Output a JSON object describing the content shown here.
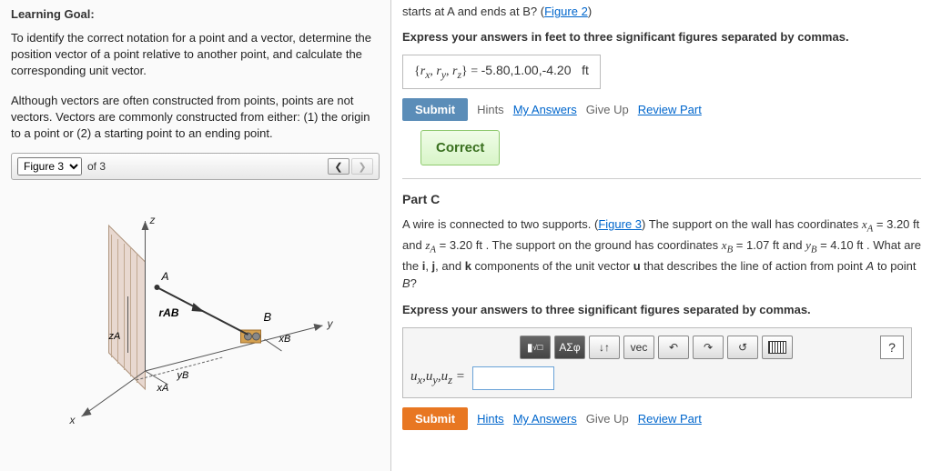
{
  "left": {
    "title": "Learning Goal:",
    "p1": "To identify the correct notation for a point and a vector, determine the position vector of a point relative to another point, and calculate the corresponding unit vector.",
    "p2": "Although vectors are often constructed from points, points are not vectors. Vectors are commonly constructed from either: (1) the origin to a point or (2) a starting point to an ending point.",
    "figSelect": "Figure 3",
    "ofText": "of 3"
  },
  "top": {
    "intro1": "starts at A and ends at B? (",
    "figLink": "Figure 2",
    "intro2": ")",
    "instruction": "Express your answers in feet to three significant figures separated by commas.",
    "answerPrefix": "{rₓ, rᵧ, r_z} = ",
    "answerValue": "-5.80,1.00,-4.20",
    "answerUnit": "ft",
    "submit": "Submit",
    "hints": "Hints",
    "myAnswers": "My Answers",
    "giveUp": "Give Up",
    "reviewPart": "Review Part",
    "correct": "Correct"
  },
  "partC": {
    "header": "Part C",
    "text1": "A wire is connected to two supports. (",
    "fig3link": "Figure 3",
    "text2": ") The support on the wall has coordinates xA = 3.20 ft and zA = 3.20 ft . The support on the ground has coordinates xB = 1.07 ft and yB = 4.10 ft . What are the i, j, and k components of the unit vector u that describes the line of action from point A to point B?",
    "instruction": "Express your answers to three significant figures separated by commas.",
    "answerLabel": "uₓ,uᵧ,u_z =",
    "submit": "Submit",
    "hints": "Hints",
    "myAnswers": "My Answers",
    "giveUp": "Give Up",
    "reviewPart": "Review Part",
    "tool_frac": "√☐",
    "tool_greek": "ΑΣφ",
    "tool_arrows": "↓↑",
    "tool_vec": "vec",
    "tool_undo": "↶",
    "tool_redo": "↷",
    "tool_reset": "↺",
    "tool_help": "?"
  }
}
